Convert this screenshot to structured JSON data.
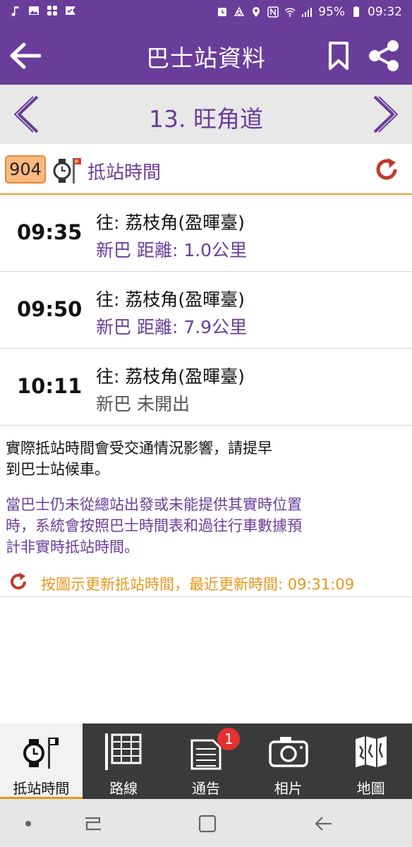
{
  "status_bar": {
    "battery": "95%",
    "time": "09:32",
    "left_icons": [
      "music-note-icon",
      "image-icon",
      "app-grid-icon",
      "check-flag-icon"
    ],
    "right_icons": [
      "alarm-icon",
      "recycle-icon",
      "location-icon",
      "nfc-icon",
      "wifi-icon",
      "signal-icon",
      "battery-icon"
    ]
  },
  "app_bar": {
    "title": "巴士站資料",
    "back_icon": "arrow-left-icon",
    "bookmark_icon": "bookmark-icon",
    "share_icon": "share-icon"
  },
  "stop_nav": {
    "stop_name": "13. 旺角道"
  },
  "route": {
    "number": "904",
    "title": "抵站時間"
  },
  "eta": [
    {
      "time": "09:35",
      "destination": "往: 荔枝角(盈暉臺)",
      "info": "新巴 距離: 1.0公里",
      "realtime": true
    },
    {
      "time": "09:50",
      "destination": "往: 荔枝角(盈暉臺)",
      "info": "新巴 距離: 7.9公里",
      "realtime": true
    },
    {
      "time": "10:11",
      "destination": "往: 荔枝角(盈暉臺)",
      "info": "新巴 未開出",
      "realtime": false
    }
  ],
  "notes": {
    "traffic_line1": "實際抵站時間會受交通情況影響，請提早",
    "traffic_line2": "到巴士站候車。",
    "schedule_line1": "當巴士仍未從總站出發或未能提供其實時位置",
    "schedule_line2": "時，系統會按照巴士時間表和過往行車數據預",
    "schedule_line3": "計非實時抵站時間。",
    "update": "按圖示更新抵站時間，最近更新時間: 09:31:09"
  },
  "tabs": [
    {
      "label": "抵站時間",
      "icon": "watch-flag-icon",
      "active": true
    },
    {
      "label": "路線",
      "icon": "route-list-icon",
      "active": false
    },
    {
      "label": "通告",
      "icon": "notice-icon",
      "active": false,
      "badge": "1"
    },
    {
      "label": "相片",
      "icon": "camera-icon",
      "active": false
    },
    {
      "label": "地圖",
      "icon": "map-icon",
      "active": false
    }
  ],
  "colors": {
    "primary": "#6a3d9a",
    "accent": "#e8961c",
    "refresh": "#c0392b",
    "badge": "#e53030"
  }
}
